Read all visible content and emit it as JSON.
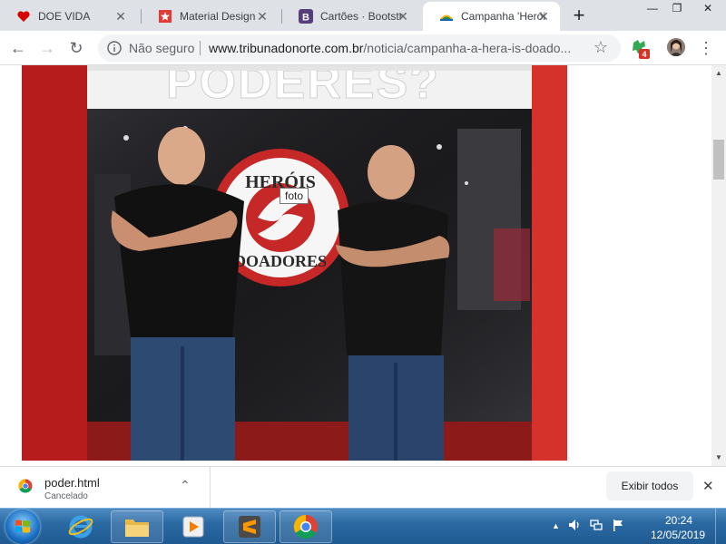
{
  "browser": {
    "tabs": [
      {
        "title": "DOE VIDA",
        "active": false,
        "favicon": "heart-icon"
      },
      {
        "title": "Material Design",
        "active": false,
        "favicon": "star-badge-icon"
      },
      {
        "title": "Cartões · Bootstr",
        "active": false,
        "favicon": "bootstrap-icon"
      },
      {
        "title": "Campanha 'Herói",
        "active": true,
        "favicon": "tribuna-icon"
      }
    ],
    "close_glyph": "✕",
    "new_tab_glyph": "+",
    "window_controls": {
      "minimize": "—",
      "restore": "❐",
      "close": "✕"
    }
  },
  "toolbar": {
    "back_glyph": "←",
    "forward_glyph": "→",
    "reload_glyph": "↻",
    "security_label": "Não seguro",
    "url_host": "www.tribunadonorte.com.br",
    "url_path": "/noticia/campanha-a-hera-is-doado...",
    "star_glyph": "☆",
    "extension_badge": "4",
    "menu_glyph": "⋮"
  },
  "page": {
    "tooltip": "foto",
    "photo_sign_top": "PODERES?",
    "photo_logo_top": "HERÓIS",
    "photo_logo_bottom": "DOADORES"
  },
  "download_shelf": {
    "file_name": "poder.html",
    "status": "Cancelado",
    "chevron_glyph": "⌃",
    "show_all_label": "Exibir todos",
    "close_glyph": "✕"
  },
  "taskbar": {
    "tray_up_glyph": "▲",
    "time": "20:24",
    "date": "12/05/2019"
  },
  "colors": {
    "tabstrip": "#dee1e6",
    "accent_red": "#c8102e",
    "taskbar_blue": "#2c6aa3"
  }
}
